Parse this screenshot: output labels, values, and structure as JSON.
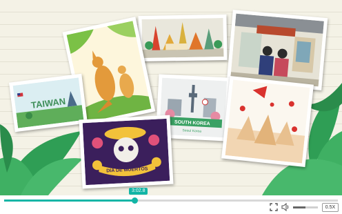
{
  "player": {
    "current_time": "3:02.8",
    "progress_fraction": 0.39,
    "volume_fraction": 0.5,
    "speed": "0.5X"
  },
  "cards": {
    "taiwan_label": "TAIWAN",
    "korea_label": "SOUTH KOREA",
    "korea_sub": "Seoul Korea",
    "muertos_label": "DIA DE MUERTOS"
  },
  "icons": {
    "fullscreen": "fullscreen-icon",
    "volume": "volume-icon"
  }
}
